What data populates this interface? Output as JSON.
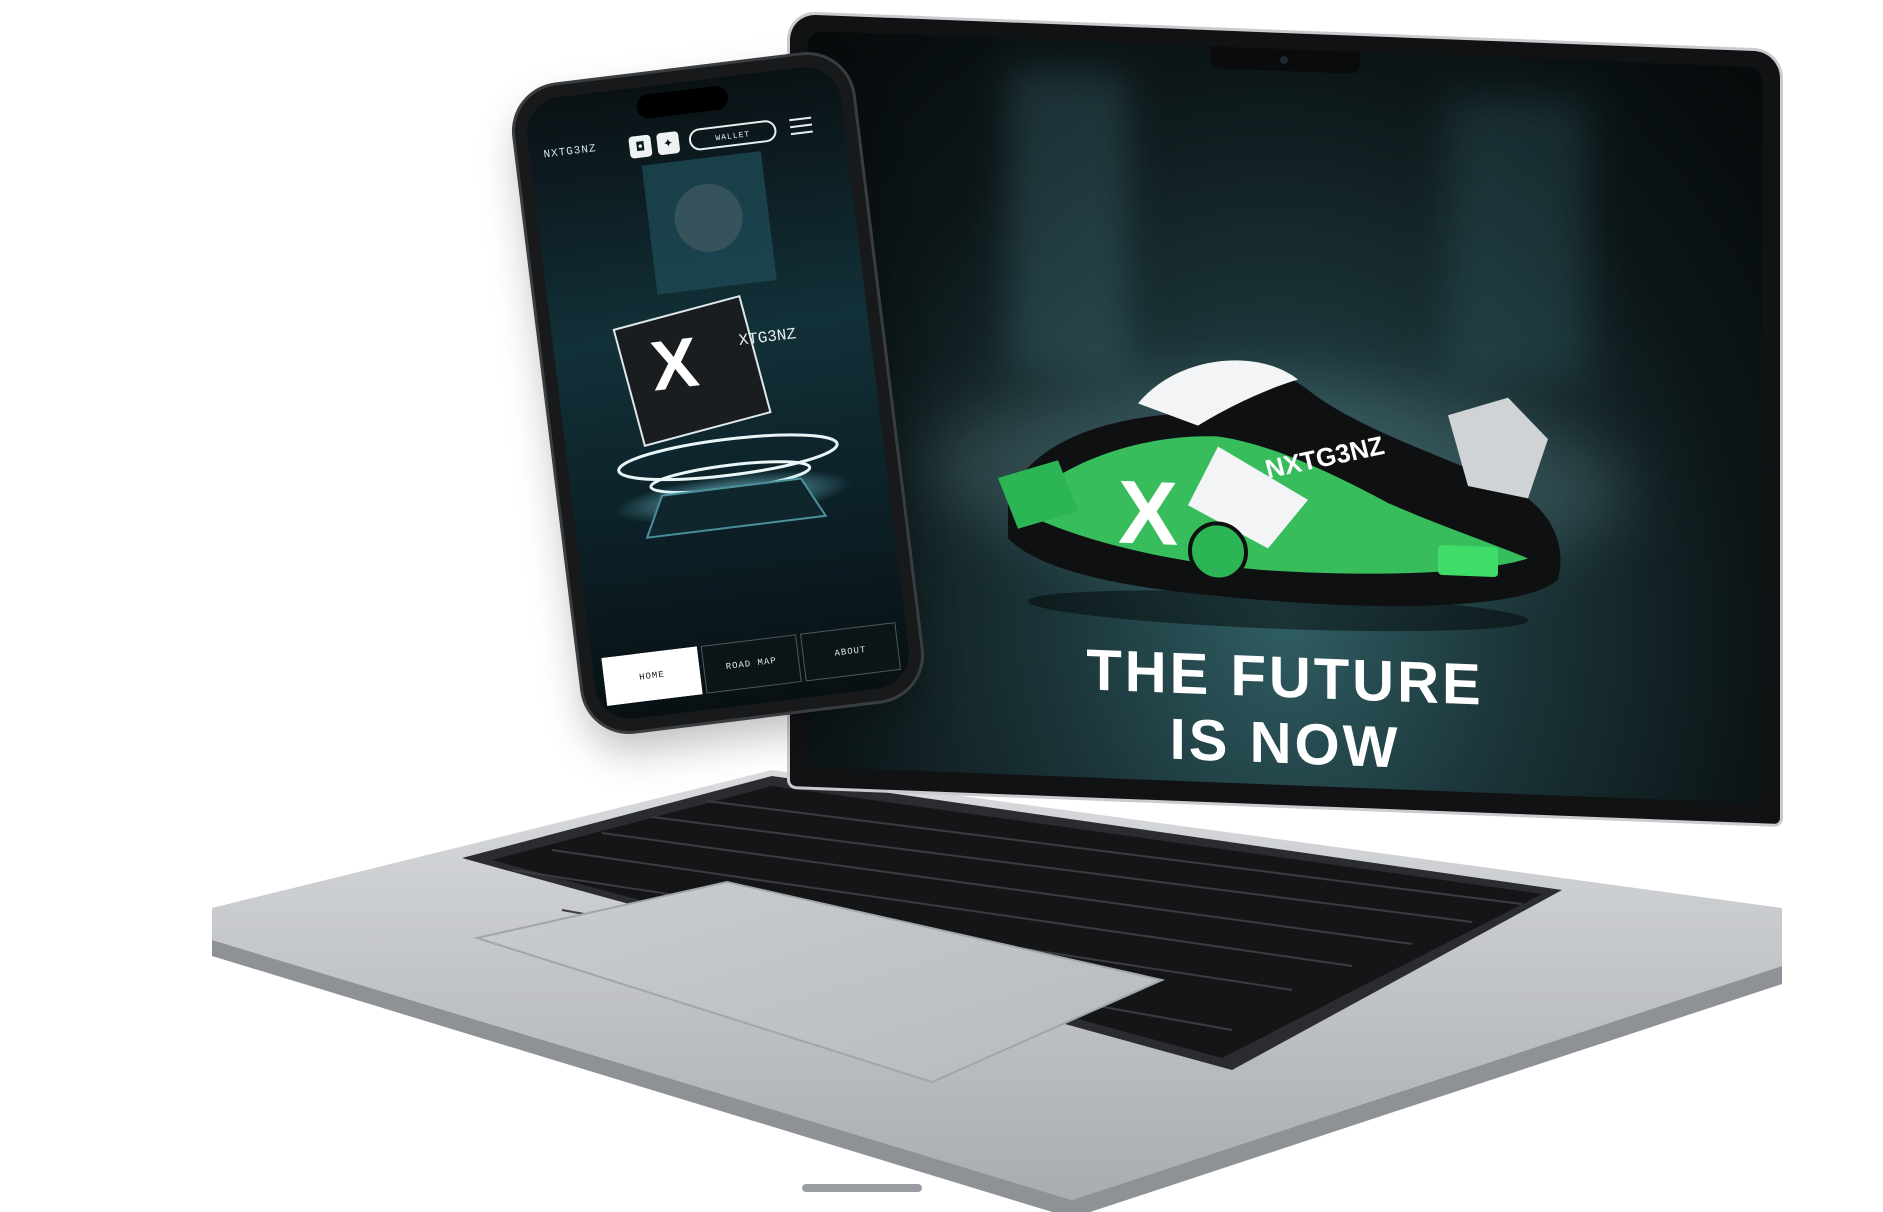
{
  "laptop": {
    "hero_headline": [
      "THE FUTURE",
      "IS NOW"
    ],
    "sneaker_brand_mark": "NXTG3NZ",
    "sneaker_letter": "X"
  },
  "phone": {
    "logo_text": "NXTG3NZ",
    "discord_icon": "discord-icon",
    "twitter_icon": "twitter-icon",
    "connect_button": "WALLET",
    "menu_icon": "hamburger-menu-icon",
    "art_brand_text": "XTG3NZ",
    "nav_tabs": [
      {
        "label": "HOME",
        "active": true
      },
      {
        "label": "ROAD MAP",
        "active": false
      },
      {
        "label": "ABOUT",
        "active": false
      }
    ]
  },
  "colors": {
    "accent_green": "#3fdc6a",
    "screen_teal": "#1b3438",
    "background": "#ffffff"
  }
}
